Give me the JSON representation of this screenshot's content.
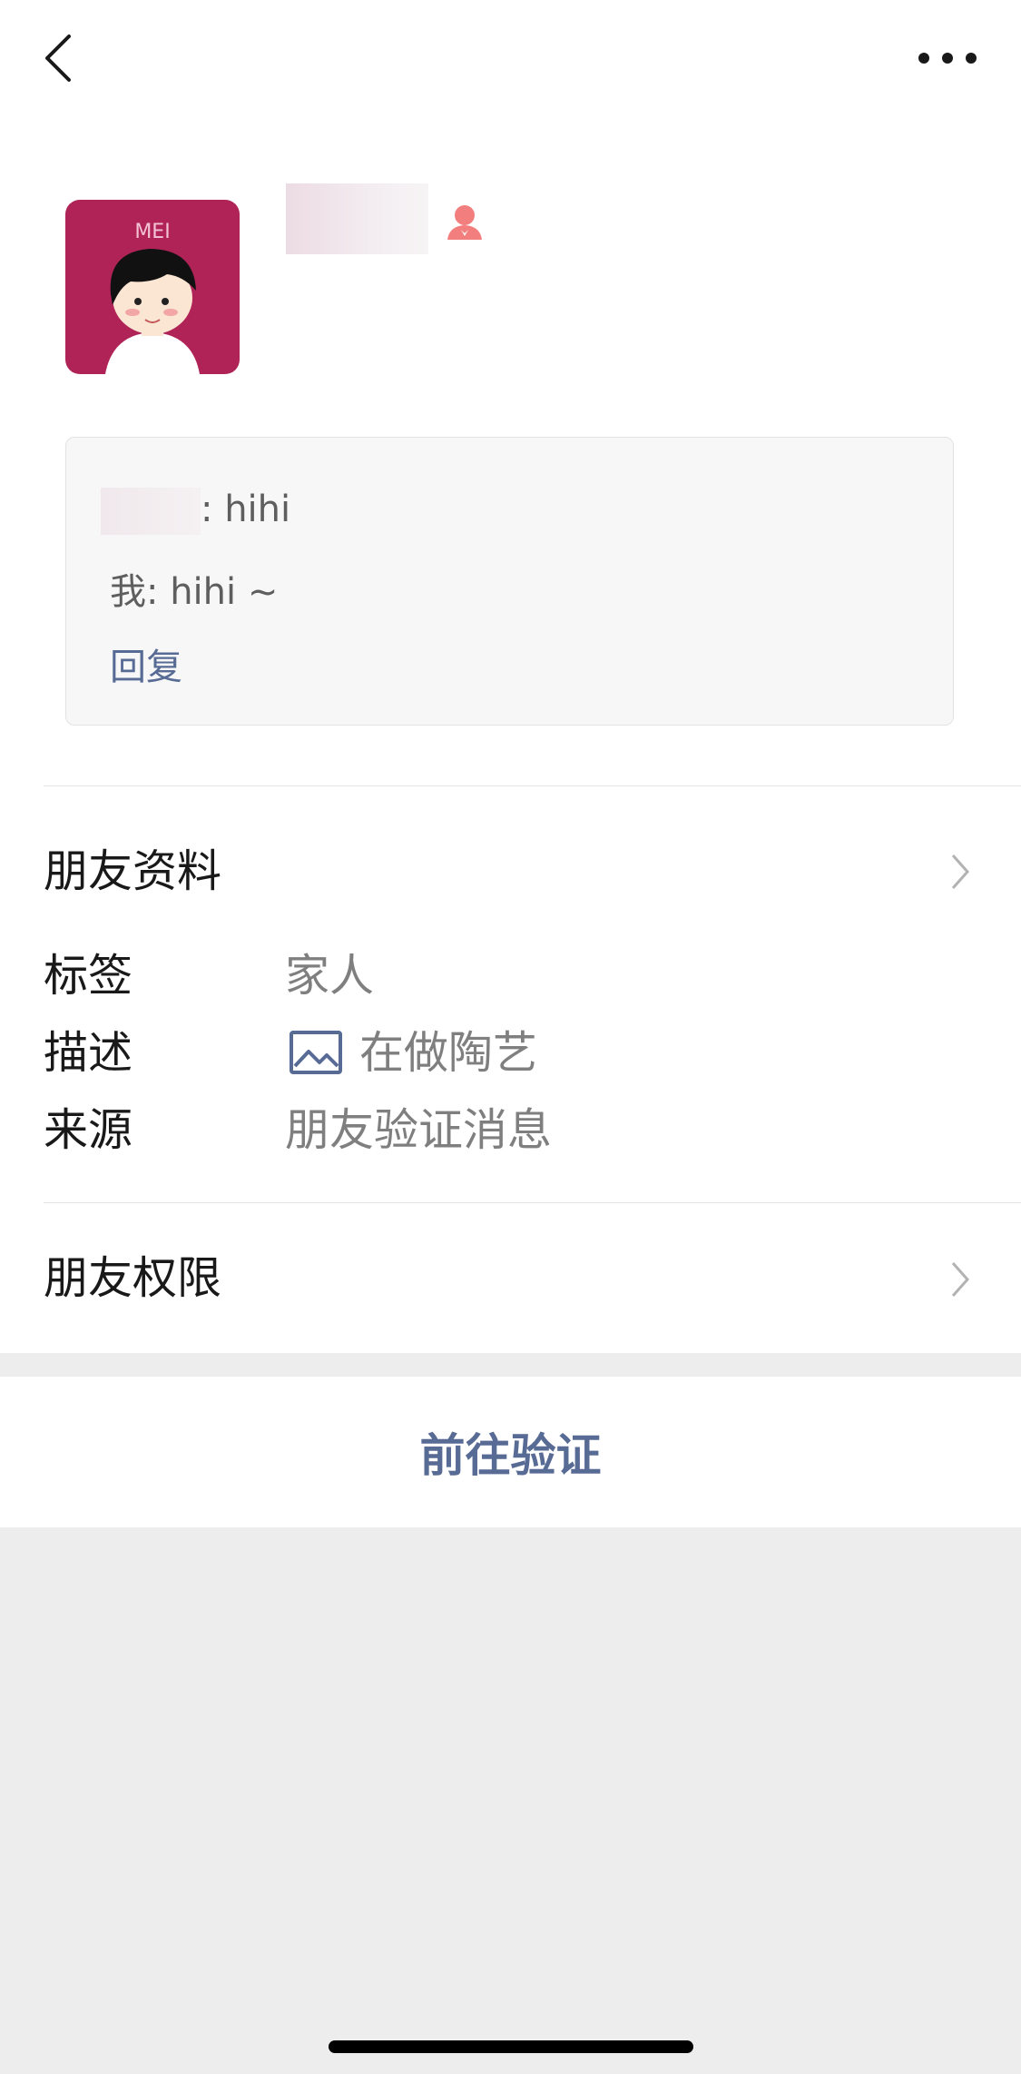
{
  "nav": {
    "back_icon": "chevron-left-icon",
    "more_icon": "more-dots-icon"
  },
  "profile": {
    "avatar_text": "MEI",
    "gender_icon": "female-user-icon",
    "gender_color": "#f37e7e"
  },
  "messages": {
    "line1": ": hihi",
    "line2": "我: hihi ~",
    "reply": "回复"
  },
  "sections": {
    "friend_info": "朋友资料",
    "friend_permissions": "朋友权限"
  },
  "info": {
    "tag_label": "标签",
    "tag_value": "家人",
    "desc_label": "描述",
    "desc_icon": "image-icon",
    "desc_value": "在做陶艺",
    "source_label": "来源",
    "source_value": "朋友验证消息"
  },
  "action": {
    "verify": "前往验证"
  },
  "colors": {
    "link": "#576b95",
    "avatar_bg": "#b02357",
    "background": "#ededed"
  }
}
